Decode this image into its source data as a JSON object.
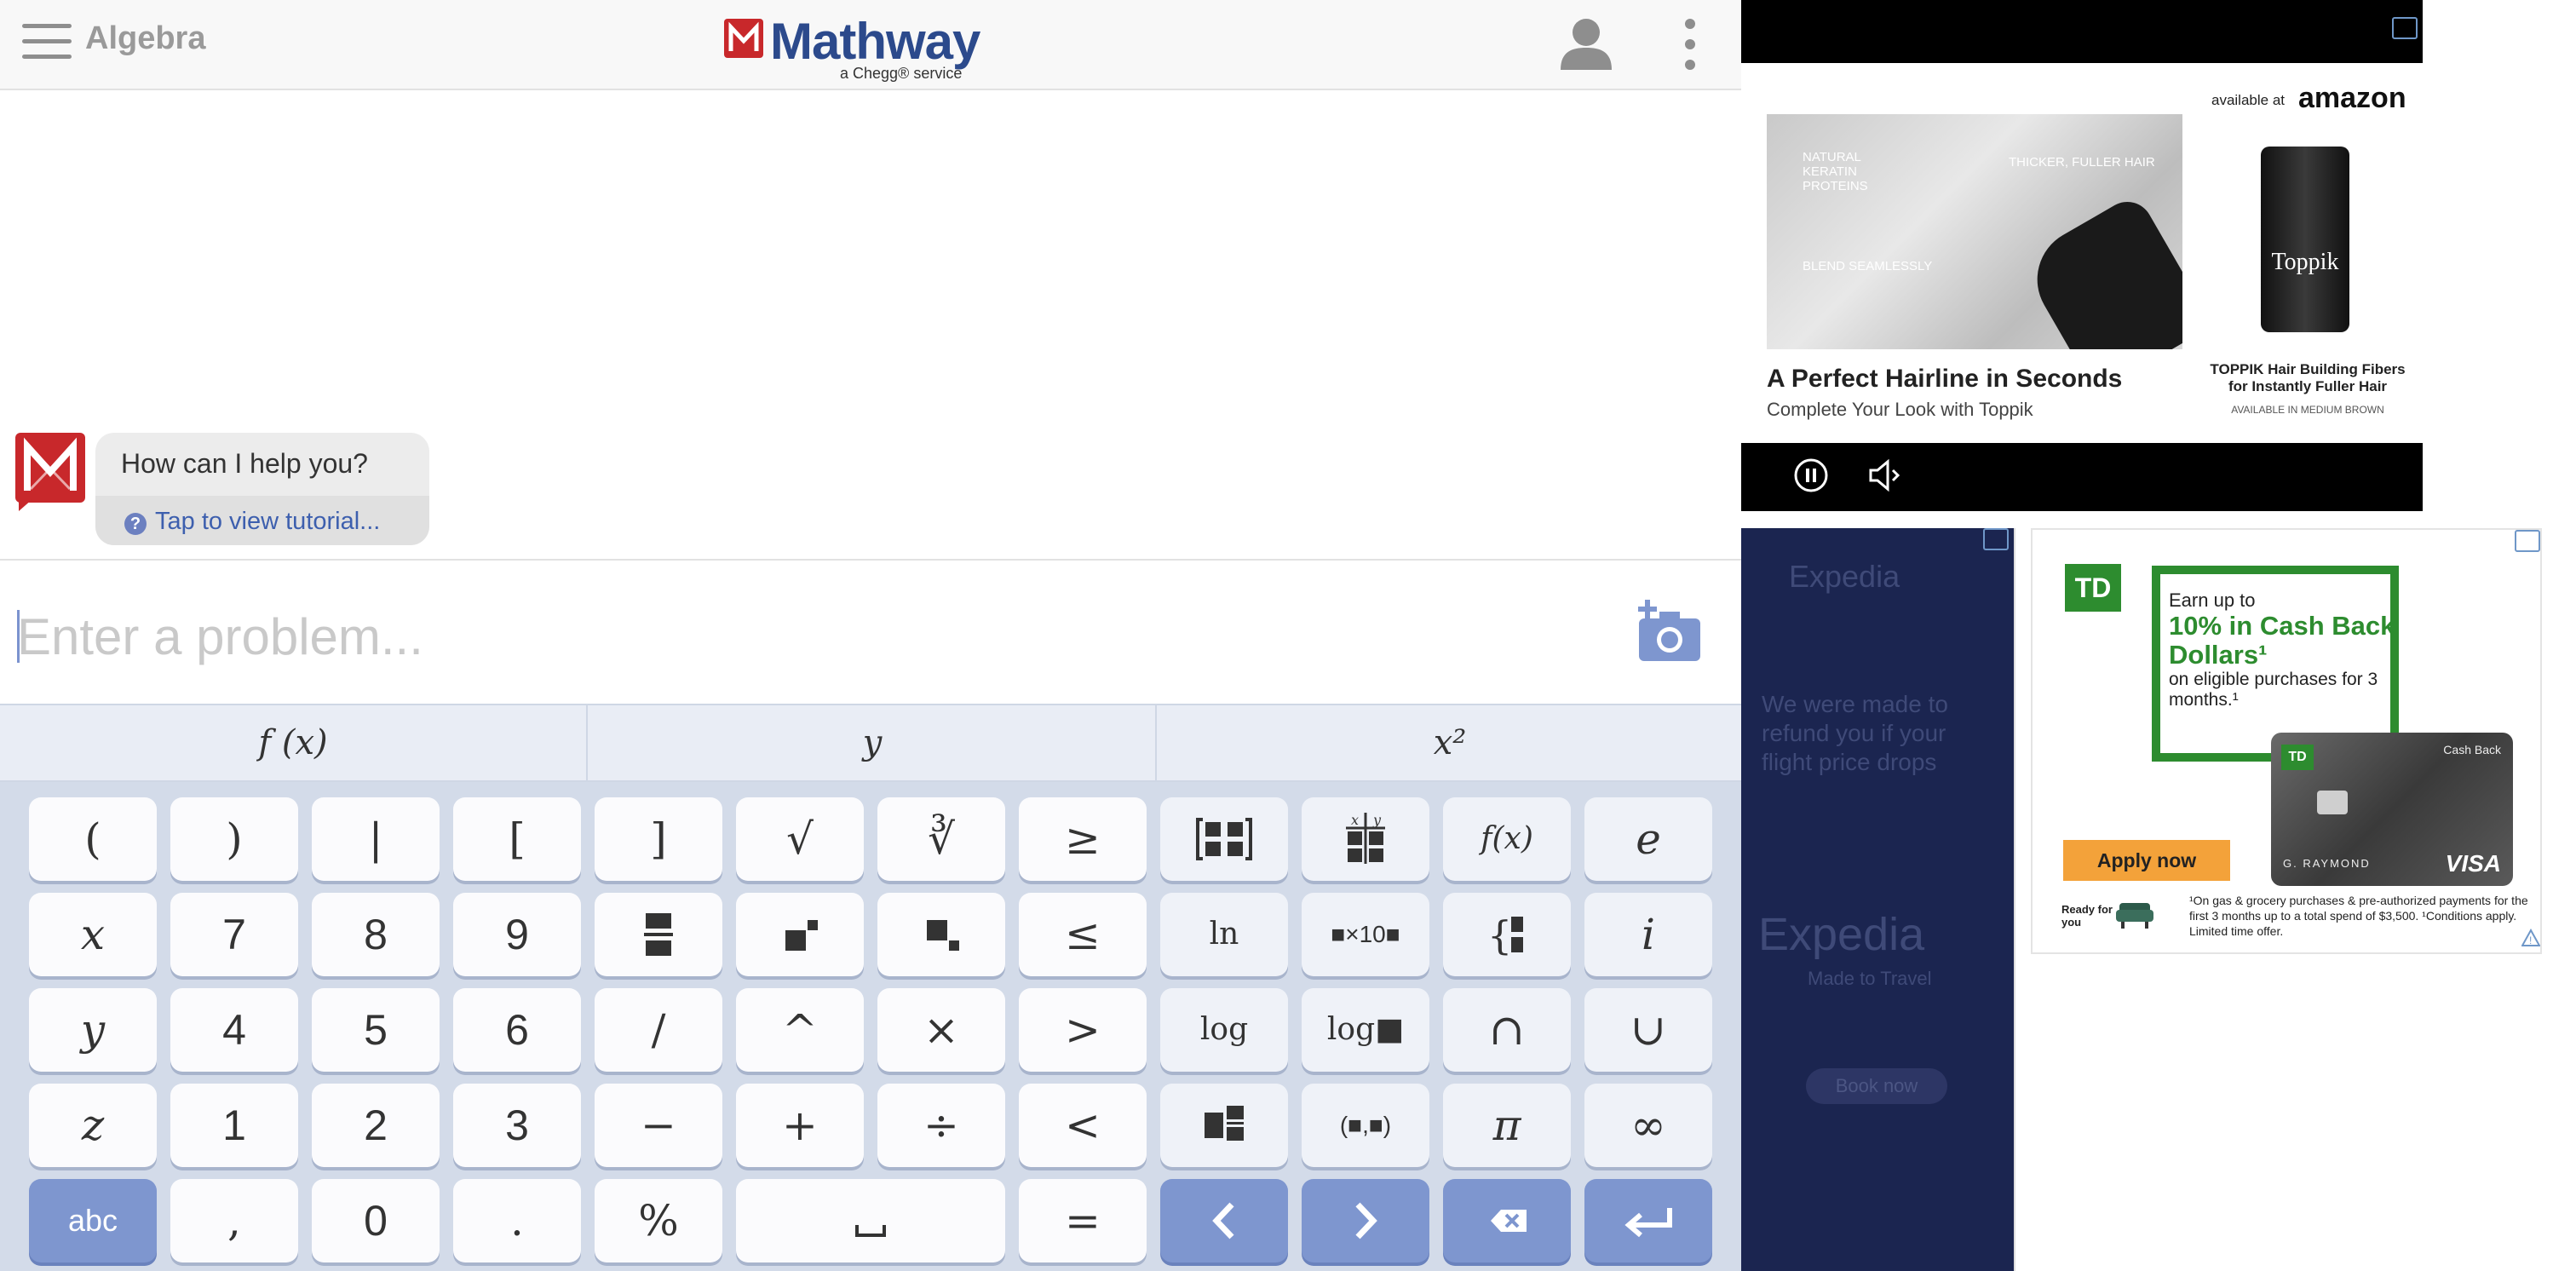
{
  "header": {
    "subject": "Algebra",
    "logo_word": "Mathway",
    "logo_sub": "a Chegg® service"
  },
  "chat": {
    "message": "How can I help you?",
    "tutorial_link": "Tap to view tutorial..."
  },
  "input": {
    "placeholder": "Enter a problem..."
  },
  "keyboard": {
    "tabs": [
      "f (x)",
      "y",
      "x²"
    ],
    "rows": [
      [
        "(",
        ")",
        "|",
        "[",
        "]",
        "√",
        "∛",
        "≥",
        "matrix",
        "table",
        "f(x)",
        "e"
      ],
      [
        "x",
        "7",
        "8",
        "9",
        "fraction",
        "superscript",
        "subscript",
        "≤",
        "ln",
        "■×10■",
        "piecewise",
        "i"
      ],
      [
        "y",
        "4",
        "5",
        "6",
        "/",
        "^",
        "×",
        ">",
        "log",
        "log■",
        "∩",
        "∪"
      ],
      [
        "z",
        "1",
        "2",
        "3",
        "−",
        "+",
        "÷",
        "<",
        "mixed-number",
        "(■,■)",
        "π",
        "∞"
      ],
      [
        "abc",
        ",",
        "0",
        ".",
        "%",
        "space",
        "=",
        "left-arrow",
        "right-arrow",
        "backspace",
        "enter"
      ]
    ]
  },
  "ads": {
    "video": {
      "photo_tags": [
        "NATURAL KERATIN PROTEINS",
        "THICKER, FULLER HAIR",
        "BLEND SEAMLESSLY"
      ],
      "headline": "A Perfect Hairline in Seconds",
      "subline": "Complete Your Look with Toppik",
      "available_at": "available at",
      "amazon": "amazon",
      "product_label": "Toppik",
      "product_title": "TOPPIK Hair Building Fibers for Instantly Fuller Hair",
      "product_note": "AVAILABLE IN MEDIUM BROWN"
    },
    "expedia": {
      "logo": "Expedia",
      "body": "We were made to refund you if your flight price drops",
      "tagline": "Made to Travel",
      "button": "Book now"
    },
    "td": {
      "logo": "TD",
      "earn": "Earn up to",
      "big": "10% in Cash Back Dollars¹",
      "eligible": "on eligible purchases for 3 months.¹",
      "card_type": "Cash Back",
      "card_name": "G. RAYMOND",
      "card_visa": "VISA",
      "apply": "Apply now",
      "ready": "Ready for you",
      "fine": "¹On gas & grocery purchases & pre-authorized payments for the first 3 months up to a total spend of $3,500. ¹Conditions apply. Limited time offer."
    }
  },
  "colors": {
    "accent": "#7e96cf",
    "brand_red": "#c8282b",
    "brand_blue": "#2c4a8c",
    "td_green": "#2d8c2f"
  }
}
